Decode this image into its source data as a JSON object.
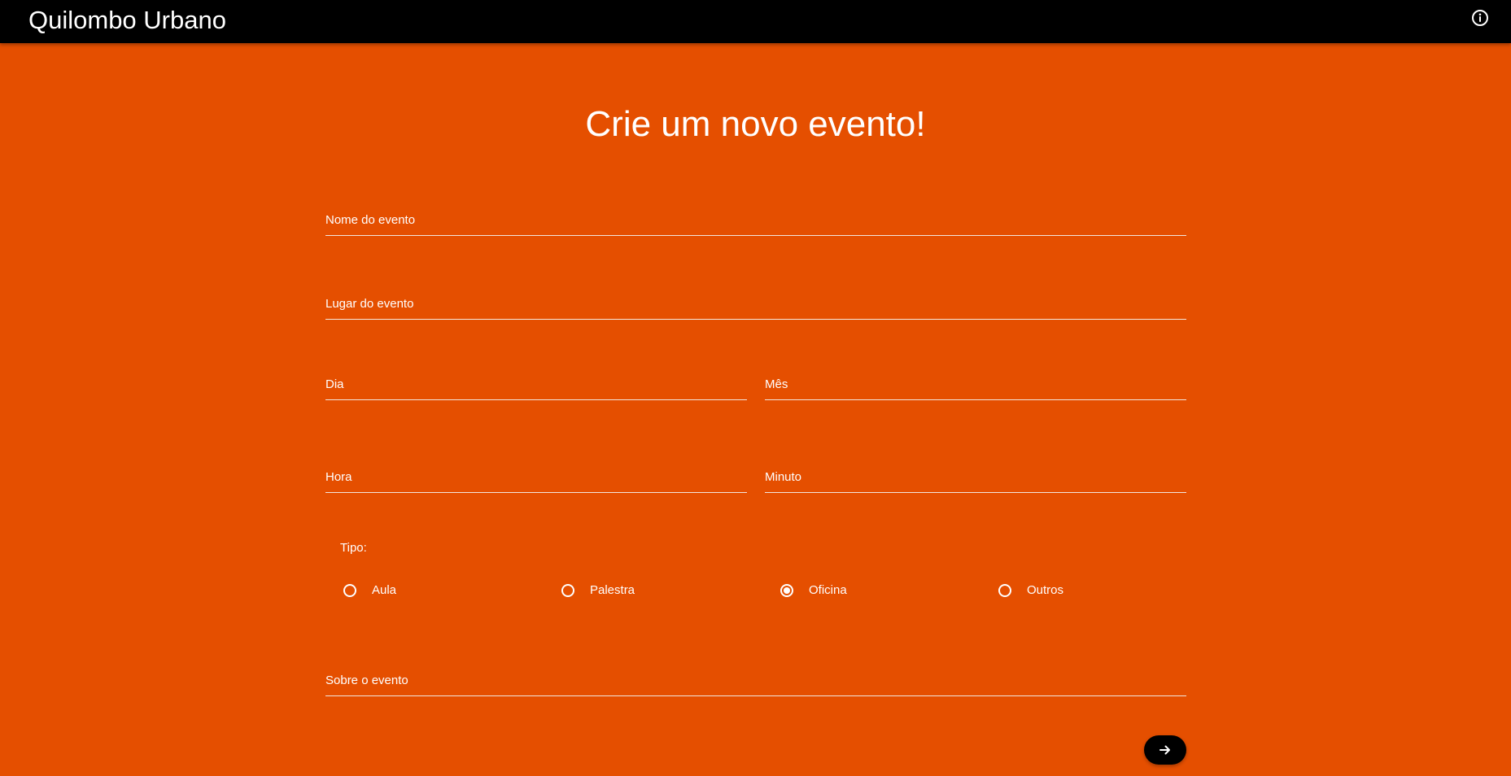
{
  "app": {
    "title": "Quilombo Urbano"
  },
  "header": {
    "info_icon": "info-icon"
  },
  "form": {
    "heading": "Crie um novo evento!",
    "fields": {
      "nome": {
        "label": "Nome do evento",
        "value": ""
      },
      "lugar": {
        "label": "Lugar do evento",
        "value": ""
      },
      "dia": {
        "label": "Dia",
        "value": ""
      },
      "mes": {
        "label": "Mês",
        "value": ""
      },
      "hora": {
        "label": "Hora",
        "value": ""
      },
      "minuto": {
        "label": "Minuto",
        "value": ""
      },
      "sobre": {
        "label": "Sobre o evento",
        "value": ""
      }
    },
    "tipo": {
      "label": "Tipo:",
      "options": [
        "Aula",
        "Palestra",
        "Oficina",
        "Outros"
      ],
      "selected": "Oficina"
    },
    "submit_icon": "arrow-right-icon"
  },
  "colors": {
    "background": "#e54f00",
    "topbar": "#000000",
    "text": "#ffffff"
  }
}
